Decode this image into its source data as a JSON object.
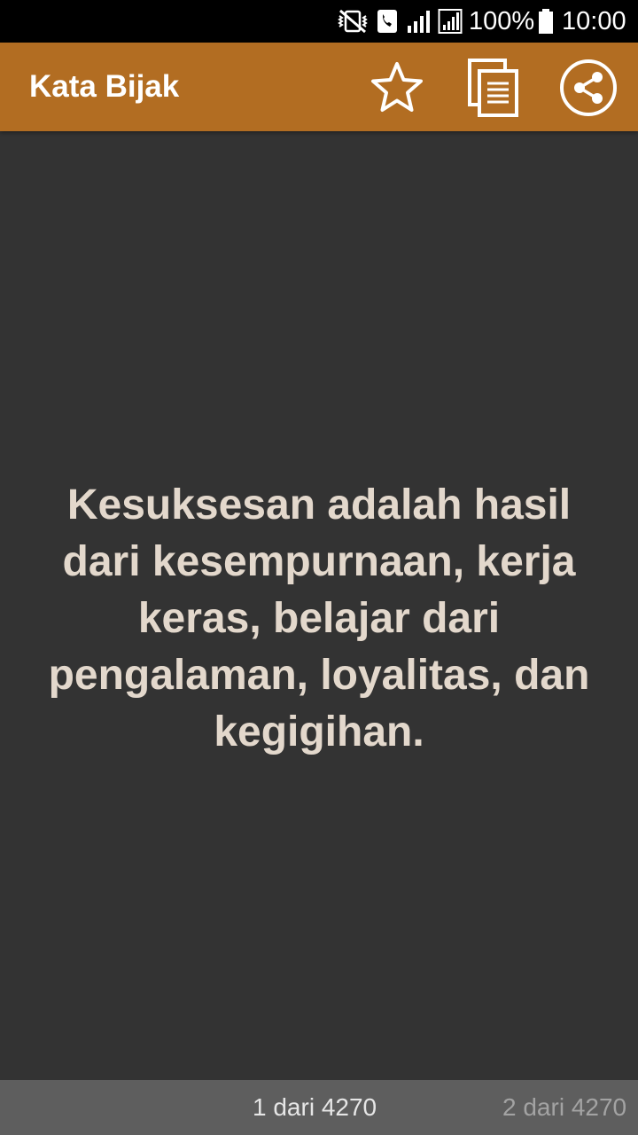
{
  "status_bar": {
    "icons": [
      "mute-vibrate-icon",
      "call-icon",
      "signal-icon",
      "signal-icon"
    ],
    "battery": "100%",
    "time": "10:00"
  },
  "app_bar": {
    "title": "Kata Bijak",
    "background": "#b26d22",
    "actions": [
      "star-icon",
      "copy-icon",
      "share-icon"
    ]
  },
  "quote": {
    "text": "Kesuksesan adalah hasil dari kesempurnaan, kerja keras, belajar dari pengalaman, loyalitas, dan kegigihan.",
    "color": "#e3d8cc"
  },
  "pager": {
    "current": "1 dari 4270",
    "next": "2 dari 4270"
  }
}
